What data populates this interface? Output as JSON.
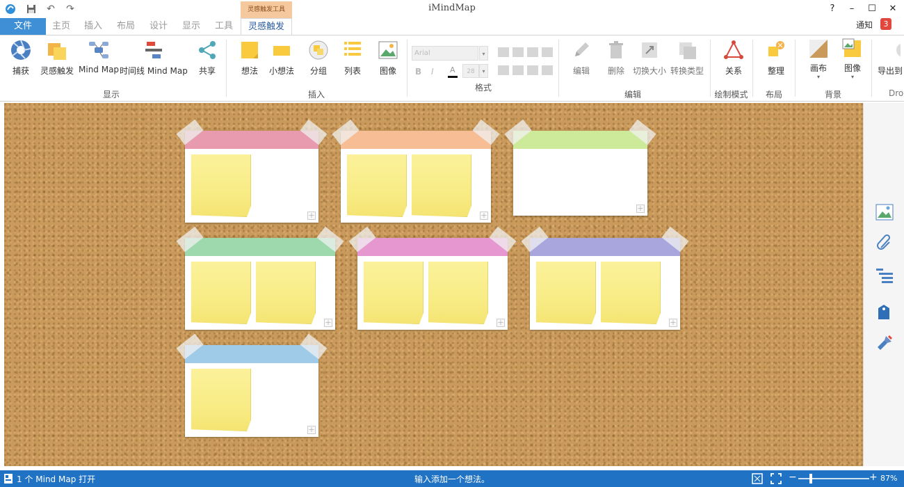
{
  "titlebar": {
    "title": "iMindMap"
  },
  "window_buttons": [
    "?",
    "–",
    "☐",
    "✕"
  ],
  "tabs": {
    "file": "文件",
    "items": [
      "主页",
      "插入",
      "布局",
      "设计",
      "显示",
      "工具"
    ],
    "context_group": "灵感触发工具",
    "active": "灵感触发"
  },
  "notify": {
    "label": "通知",
    "count": "3"
  },
  "ribbon": {
    "display": {
      "items": [
        "捕获",
        "灵感触发",
        "Mind Map",
        "时间线 Mind Map",
        "共享"
      ],
      "group": "显示"
    },
    "insert": {
      "items": [
        "想法",
        "小想法",
        "分组",
        "列表",
        "图像"
      ],
      "group": "插入"
    },
    "format": {
      "font": "Arial",
      "size": "28",
      "bold": "B",
      "italic": "I",
      "group": "格式"
    },
    "edit": {
      "items": [
        "编辑",
        "删除",
        "切换大小",
        "转换类型"
      ],
      "group": "编辑"
    },
    "draw": {
      "items": [
        "关系"
      ],
      "group": "绘制模式"
    },
    "layout": {
      "items": [
        "整理"
      ],
      "group": "布局"
    },
    "background": {
      "items": [
        "画布",
        "图像"
      ],
      "group": "背景"
    },
    "export": {
      "items": [
        "导出到"
      ],
      "group": "Dro"
    }
  },
  "cards": [
    {
      "color": "#e89aae",
      "notes": 1
    },
    {
      "color": "#f7be96",
      "notes": 2
    },
    {
      "color": "#cde99a",
      "notes": 0
    },
    {
      "color": "#9dd9ad",
      "notes": 2
    },
    {
      "color": "#e697cf",
      "notes": 2
    },
    {
      "color": "#a9a6dd",
      "notes": 2
    },
    {
      "color": "#9fcbe9",
      "notes": 1
    }
  ],
  "status": {
    "left": "1 个 Mind Map 打开",
    "center": "输入添加一个想法。",
    "zoom": "87%",
    "zoom_level": 0.18
  },
  "colors": {
    "accent": "#3f8fd6",
    "statusbar": "#1f72c4",
    "cork": "#c99a5b"
  }
}
